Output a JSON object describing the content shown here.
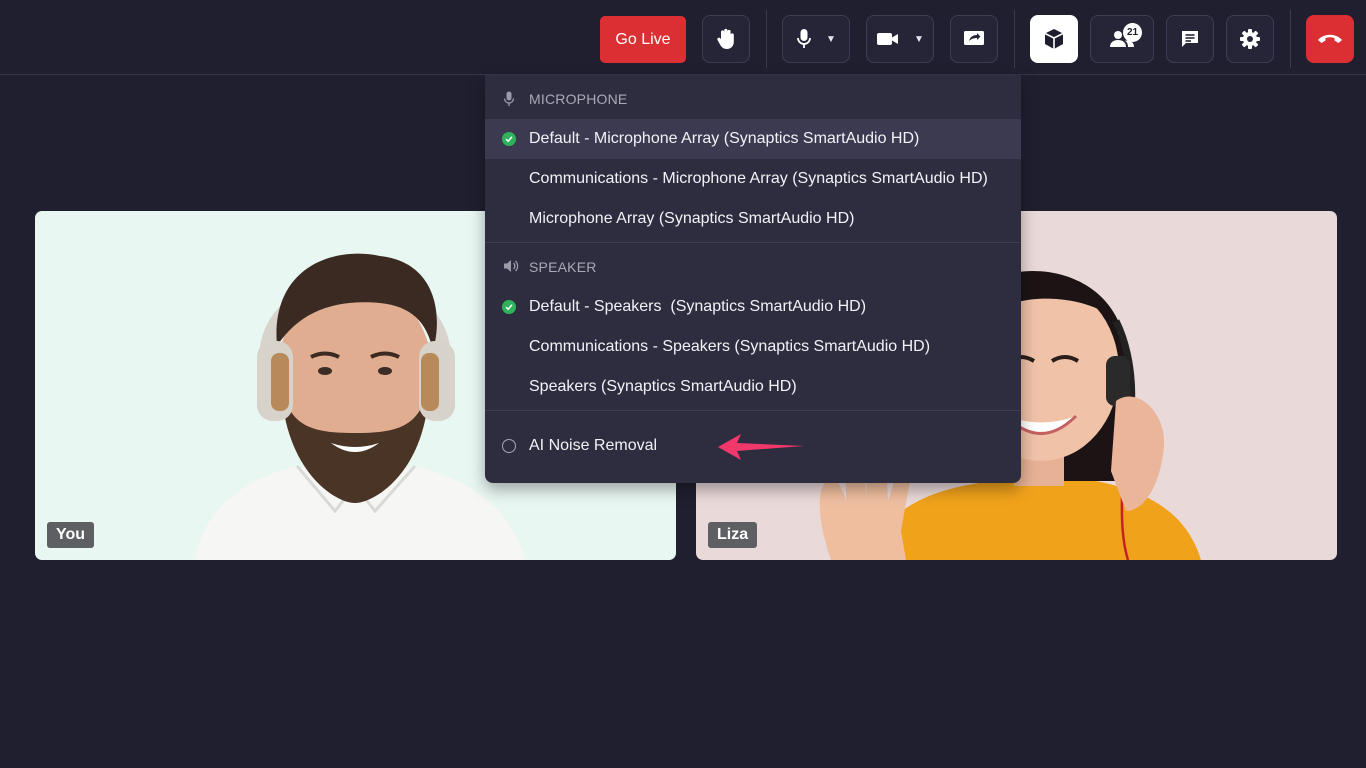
{
  "toolbar": {
    "go_live_label": "Go Live",
    "participants_count": "21",
    "icons": [
      "raise-hand-icon",
      "microphone-icon",
      "camera-icon",
      "screen-share-icon",
      "box-icon",
      "participants-icon",
      "chat-icon",
      "settings-icon",
      "end-call-icon"
    ],
    "end_call_color": "#dc2f33"
  },
  "audio_menu": {
    "microphone": {
      "heading": "MICROPHONE",
      "items": [
        {
          "label": "Default - Microphone Array (Synaptics SmartAudio HD)",
          "selected": true
        },
        {
          "label": "Communications - Microphone Array (Synaptics SmartAudio HD)",
          "selected": false
        },
        {
          "label": "Microphone Array (Synaptics SmartAudio HD)",
          "selected": false
        }
      ]
    },
    "speaker": {
      "heading": "SPEAKER",
      "items": [
        {
          "label": "Default - Speakers  (Synaptics SmartAudio HD)",
          "selected": true
        },
        {
          "label": "Communications - Speakers (Synaptics SmartAudio HD)",
          "selected": false
        },
        {
          "label": "Speakers (Synaptics SmartAudio HD)",
          "selected": false
        }
      ]
    },
    "noise_removal": {
      "label": "AI Noise Removal",
      "enabled": false
    }
  },
  "tiles": [
    {
      "name": "You"
    },
    {
      "name": "Liza"
    }
  ],
  "colors": {
    "background": "#201f30",
    "menu": "#2e2d40",
    "selected_check": "#2fb25c",
    "annotation_arrow": "#f0386b"
  }
}
